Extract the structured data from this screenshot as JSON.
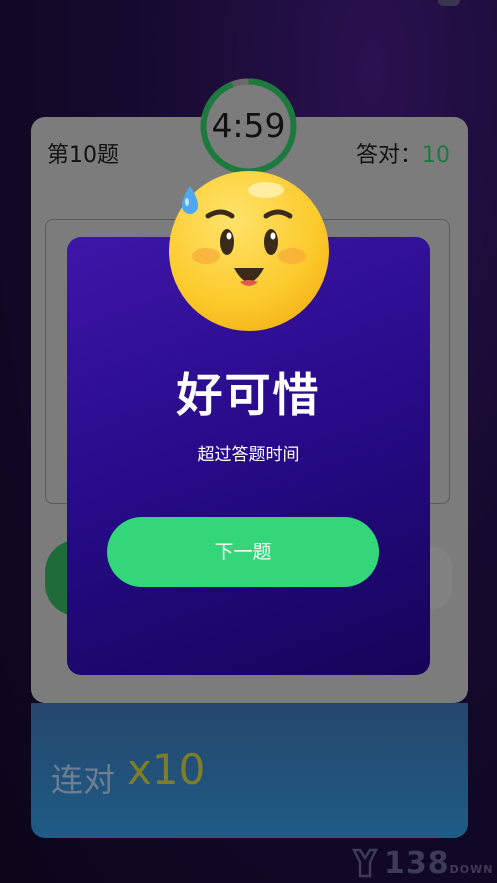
{
  "quiz": {
    "question_number": "第10题",
    "correct_label": "答对：",
    "correct_count": "10",
    "timer": "4:59",
    "timer_progress": 0.94
  },
  "streak": {
    "label": "连对",
    "multiplier": "x10"
  },
  "modal": {
    "title": "好可惜",
    "subtitle": "超过答题时间",
    "next_button": "下一题"
  },
  "watermark": {
    "text": "138",
    "suffix": "DOWN"
  },
  "colors": {
    "accent_green": "#34d67a",
    "modal_purple": "#2b0d8f",
    "timer_ring": "#1c7a3e"
  }
}
